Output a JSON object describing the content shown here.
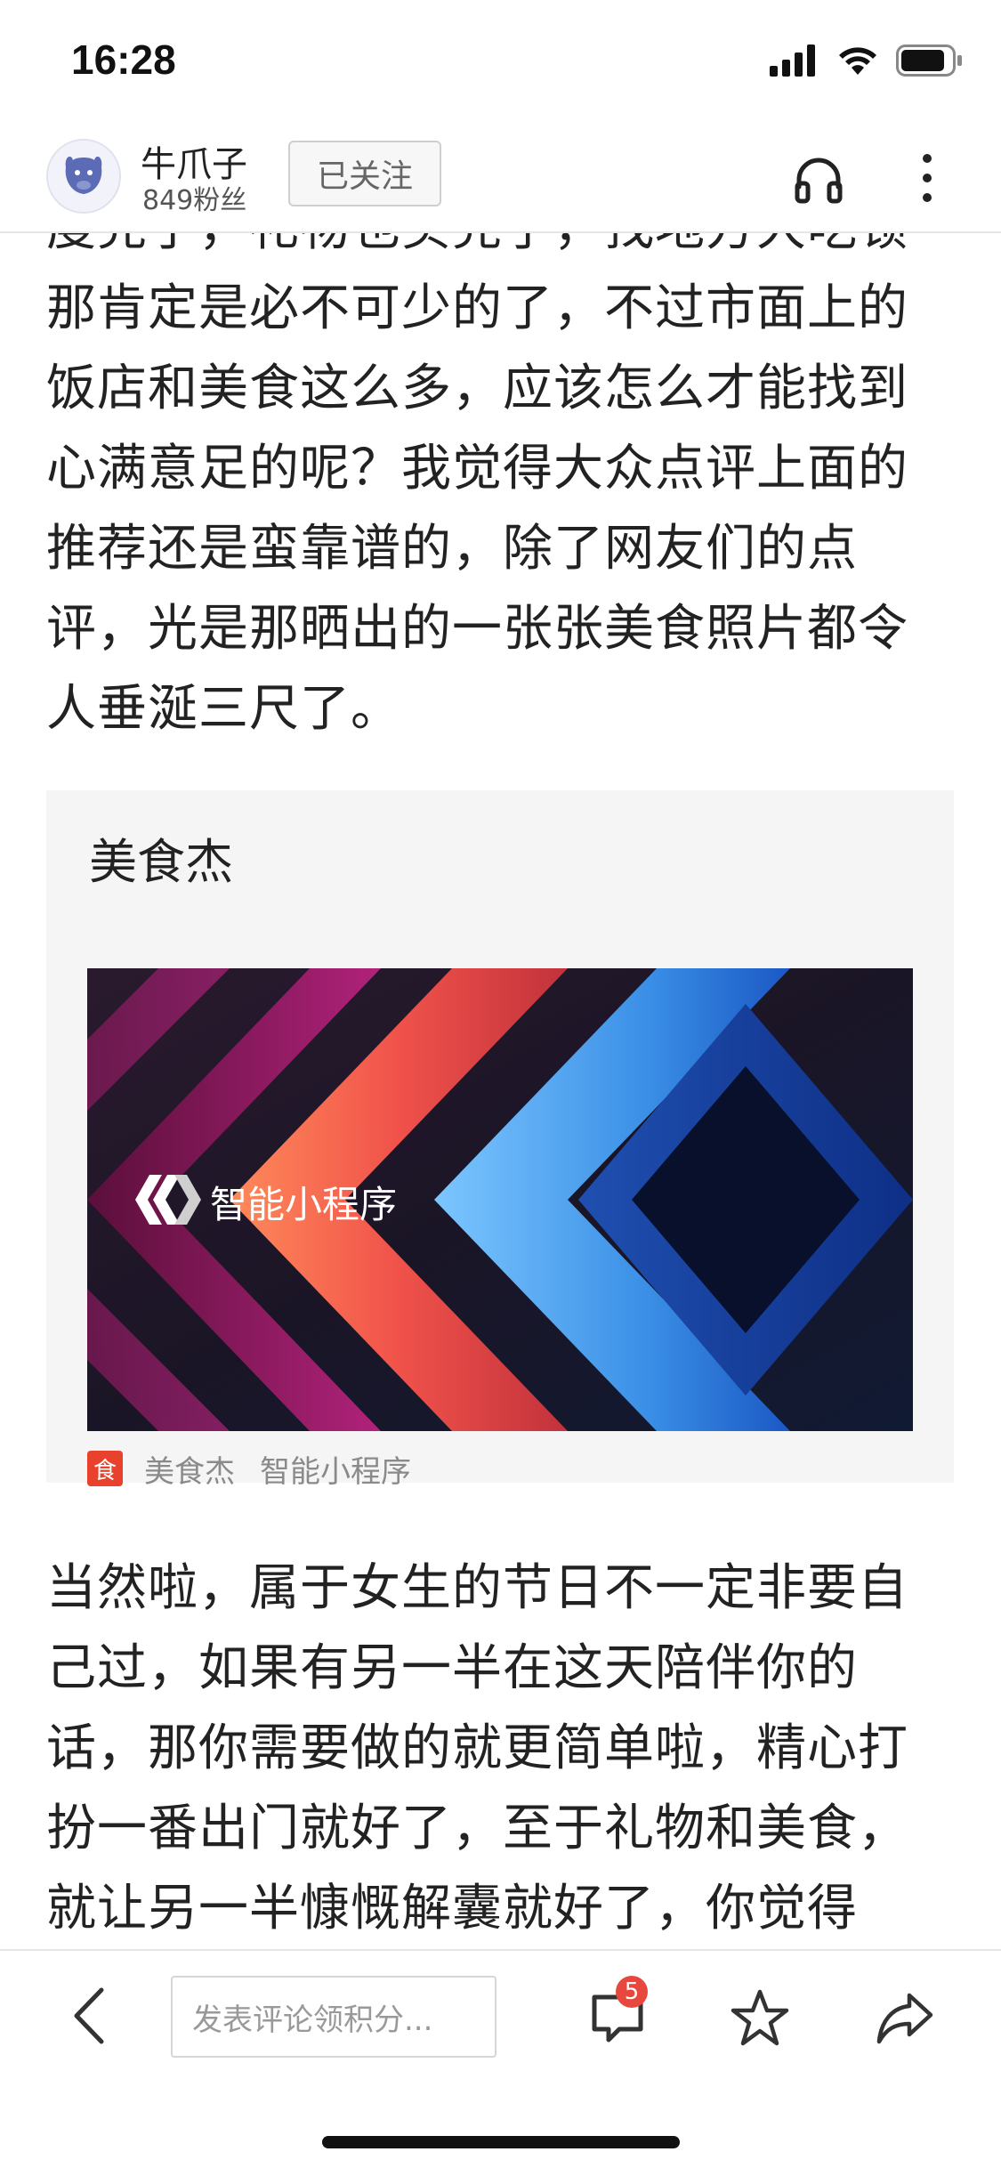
{
  "status_bar": {
    "time": "16:28",
    "icons": [
      "cellular-signal-icon",
      "wifi-icon",
      "battery-icon"
    ]
  },
  "header": {
    "author_name": "牛爪子",
    "fans": "849粉丝",
    "follow_label": "已关注",
    "icons": [
      "avatar",
      "headphones-icon",
      "more-vertical-icon"
    ]
  },
  "article": {
    "paragraph_top": "度完了，礼物也买完了，找地方大吃顿那肯定是必不可少的了，不过市面上的饭店和美食这么多，应该怎么才能找到心满意足的呢？我觉得大众点评上面的推荐还是蛮靠谱的，除了网友们的点评，光是那晒出的一张张美食照片都令人垂涎三尺了。",
    "paragraph_bottom": "当然啦，属于女生的节日不一定非要自己过，如果有另一半在这天陪伴你的话，那你需要做的就更简单啦，精心打扮一番出门就好了，至于礼物和美食，就让另一半慷慨解囊就好了，你觉得"
  },
  "mini_program_card": {
    "title": "美食杰",
    "banner_label": "智能小程序",
    "footer_icon_glyph": "食",
    "footer_name": "美食杰",
    "footer_type": "智能小程序"
  },
  "bottom_bar": {
    "comment_placeholder": "发表评论领积分...",
    "comment_count": "5",
    "icons": [
      "back-icon",
      "comments-icon",
      "star-icon",
      "share-icon"
    ]
  },
  "colors": {
    "badge": "#e8473f",
    "card_bg": "#f5f5f5",
    "footer_icon": "#e8412c"
  }
}
